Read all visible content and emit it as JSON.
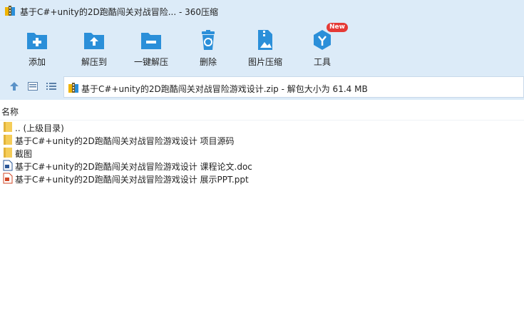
{
  "window": {
    "title": "基于C#+unity的2D跑酷闯关对战冒险... - 360压缩"
  },
  "toolbar": {
    "items": [
      {
        "label": "添加",
        "icon": "add-icon"
      },
      {
        "label": "解压到",
        "icon": "extract-to-icon"
      },
      {
        "label": "一键解压",
        "icon": "one-click-extract-icon"
      },
      {
        "label": "删除",
        "icon": "delete-icon"
      },
      {
        "label": "图片压缩",
        "icon": "image-compress-icon"
      },
      {
        "label": "工具",
        "icon": "tools-icon",
        "badge": "New"
      }
    ]
  },
  "path": {
    "text": "基于C#+unity的2D跑酷闯关对战冒险游戏设计.zip - 解包大小为 61.4 MB"
  },
  "list": {
    "column_name": "名称",
    "rows": [
      {
        "name": ".. (上级目录)",
        "type": "folder"
      },
      {
        "name": "基于C#+unity的2D跑酷闯关对战冒险游戏设计 项目源码",
        "type": "folder"
      },
      {
        "name": "截图",
        "type": "folder"
      },
      {
        "name": "基于C#+unity的2D跑酷闯关对战冒险游戏设计 课程论文.doc",
        "type": "doc"
      },
      {
        "name": "基于C#+unity的2D跑酷闯关对战冒险游戏设计 展示PPT.ppt",
        "type": "ppt"
      }
    ]
  },
  "colors": {
    "toolbar_bg": "#dcebf8",
    "icon_blue": "#2b8fd9",
    "badge_red": "#e53935",
    "folder_yellow": "#f5cd58"
  }
}
